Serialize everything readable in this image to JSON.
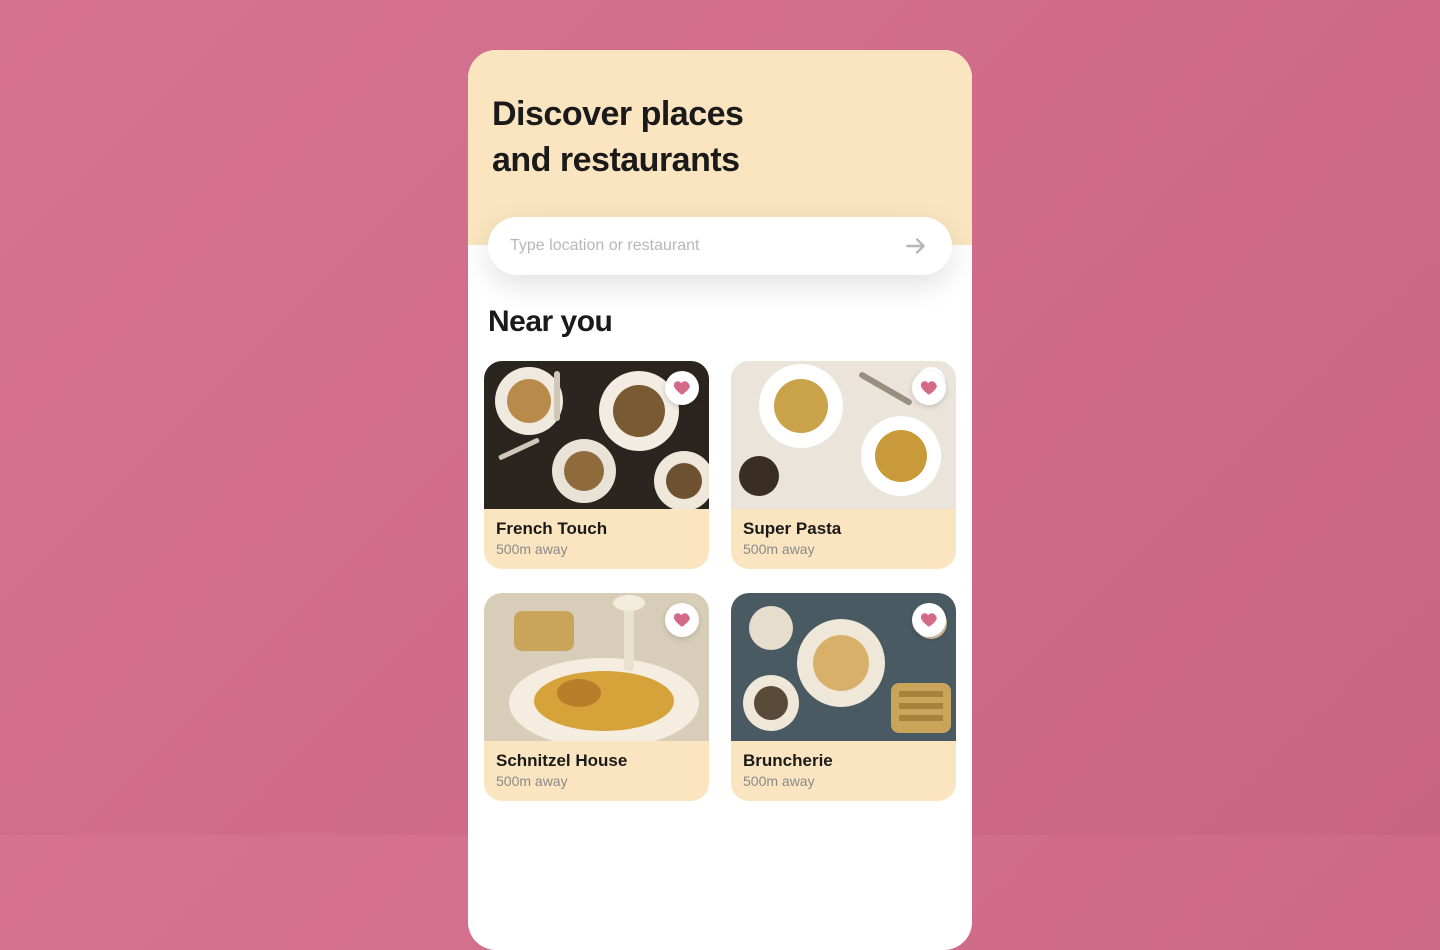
{
  "hero": {
    "title_line1": "Discover places",
    "title_line2": "and restaurants"
  },
  "search": {
    "placeholder": "Type location or restaurant",
    "value": ""
  },
  "section": {
    "near_you_label": "Near you"
  },
  "colors": {
    "accent_peach": "#fae5c0",
    "heart": "#d46a87",
    "bg_pink": "#cf6a87"
  },
  "cards": [
    {
      "name": "French Touch",
      "distance": "500m away"
    },
    {
      "name": "Super Pasta",
      "distance": "500m away"
    },
    {
      "name": "Schnitzel House",
      "distance": "500m away"
    },
    {
      "name": "Bruncherie",
      "distance": "500m away"
    }
  ]
}
